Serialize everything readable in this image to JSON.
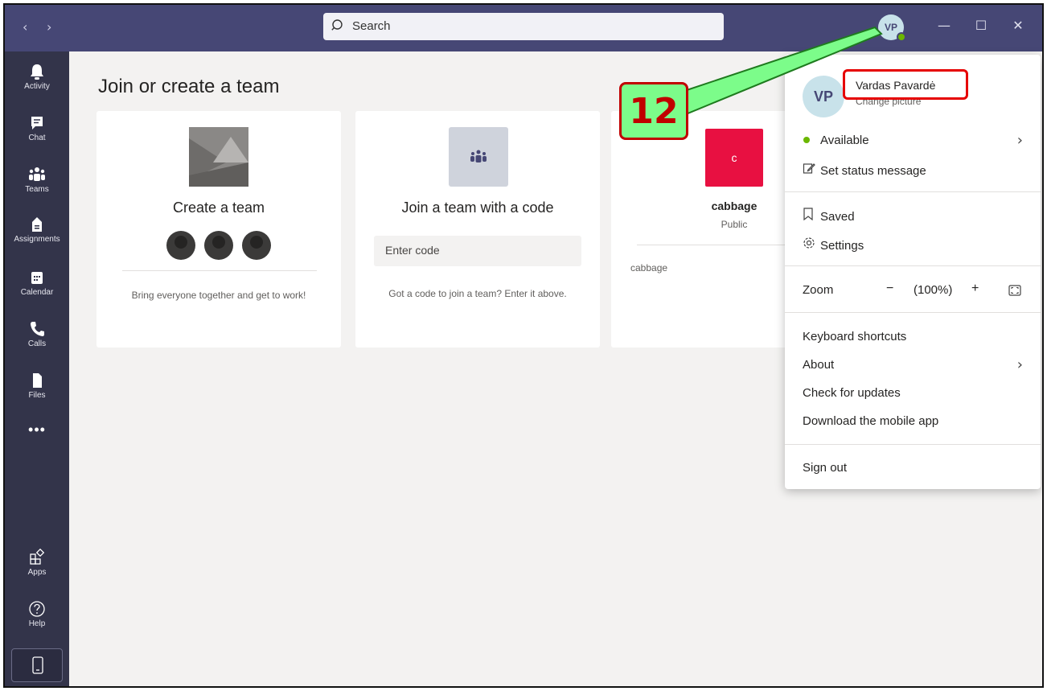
{
  "titlebar": {
    "search_placeholder": "Search",
    "avatar_initials": "VP",
    "nav_back": "‹",
    "nav_forward": "›",
    "minimize": "—",
    "maximize": "☐",
    "close": "✕"
  },
  "rail": {
    "items": [
      {
        "label": "Activity",
        "icon": "bell-icon"
      },
      {
        "label": "Chat",
        "icon": "chat-icon"
      },
      {
        "label": "Teams",
        "icon": "teams-icon"
      },
      {
        "label": "Assignments",
        "icon": "assignments-icon"
      },
      {
        "label": "Calendar",
        "icon": "calendar-icon"
      },
      {
        "label": "Calls",
        "icon": "phone-icon"
      },
      {
        "label": "Files",
        "icon": "file-icon"
      }
    ],
    "more": "•••",
    "apps_label": "Apps",
    "help_label": "Help"
  },
  "main": {
    "title": "Join or create a team",
    "create_card": {
      "title": "Create a team",
      "description": "Bring everyone together and get to work!"
    },
    "join_card": {
      "title": "Join a team with a code",
      "input_placeholder": "Enter code",
      "description": "Got a code to join a team? Enter it above."
    },
    "team_card": {
      "tile_letter": "c",
      "name": "cabbage",
      "visibility": "Public",
      "description": "cabbage",
      "tile_color": "#e81041"
    }
  },
  "menu": {
    "avatar_initials": "VP",
    "user_name": "Vardas Pavardė",
    "change_picture": "Change picture",
    "status": "Available",
    "set_status": "Set status message",
    "saved": "Saved",
    "settings": "Settings",
    "zoom_label": "Zoom",
    "zoom_minus": "−",
    "zoom_value": "(100%)",
    "zoom_plus": "+",
    "keyboard_shortcuts": "Keyboard shortcuts",
    "about": "About",
    "check_updates": "Check for updates",
    "download_mobile": "Download the mobile app",
    "sign_out": "Sign out"
  },
  "annotation": {
    "step_number": "12"
  },
  "colors": {
    "titlebar": "#464775",
    "rail": "#33344a",
    "available": "#6bb700",
    "highlight": "#e60000"
  }
}
